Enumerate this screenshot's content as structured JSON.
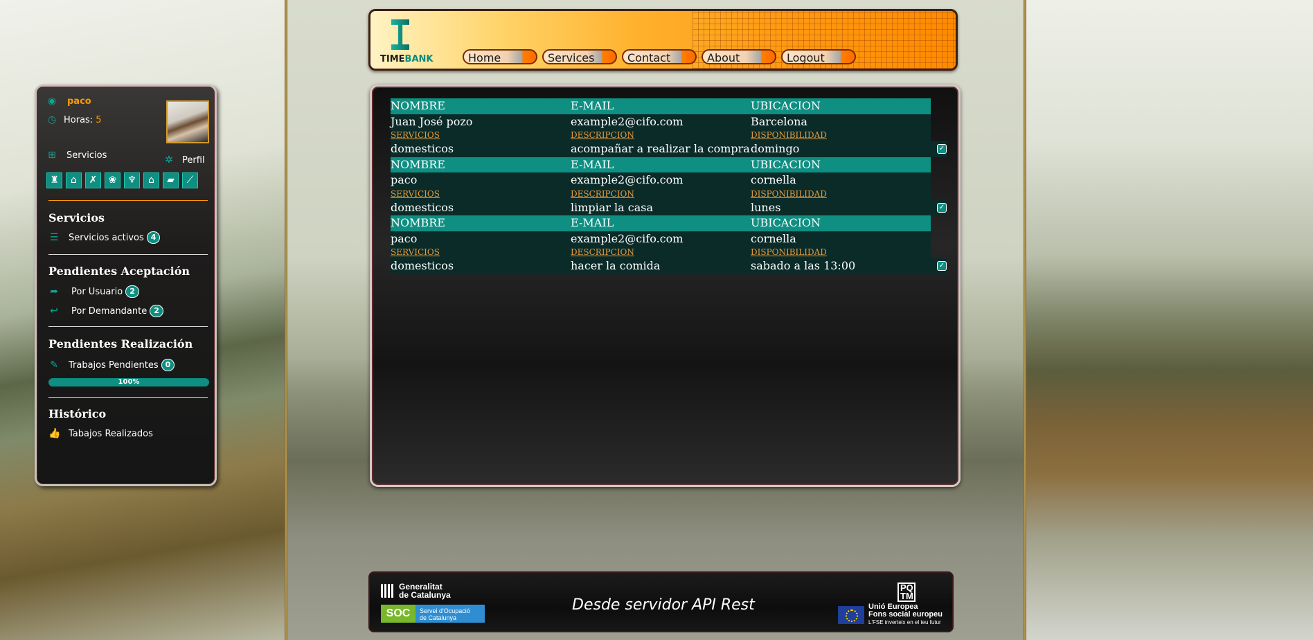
{
  "header": {
    "logo_time": "TIME",
    "logo_bank": "BANK",
    "nav": [
      "Home",
      "Services",
      "Contact",
      "About",
      "Logout"
    ]
  },
  "sidebar": {
    "username": "paco",
    "horas_label": "Horas:",
    "horas_value": "5",
    "servicios_link": "Servicios",
    "perfil_link": "Perfil",
    "service_icons": [
      "babysitter-icon",
      "house-cleaning-icon",
      "broom-icon",
      "gardening-icon",
      "plumbing-icon",
      "home-repair-icon",
      "ironing-icon",
      "sweeping-icon"
    ],
    "sections": {
      "servicios_title": "Servicios",
      "servicios_activos": "Servicios activos",
      "servicios_activos_count": "4",
      "pendientes_aceptacion_title": "Pendientes Aceptación",
      "por_usuario": "Por Usuario",
      "por_usuario_count": "2",
      "por_demandante": "Por Demandante",
      "por_demandante_count": "2",
      "pendientes_realizacion_title": "Pendientes Realización",
      "trabajos_pendientes": "Trabajos Pendientes",
      "trabajos_pendientes_count": "0",
      "progress_label": "100%",
      "progress_value": 100,
      "historico_title": "Histórico",
      "trabajos_realizados": "Tabajos Realizados"
    }
  },
  "table": {
    "headers": [
      "NOMBRE",
      "E-MAIL",
      "UBICACION"
    ],
    "subheaders": [
      "SERVICIOS",
      "DESCRIPCION",
      "DISPONIBILIDAD"
    ],
    "records": [
      {
        "nombre": "Juan José pozo",
        "email": "example2@cifo.com",
        "ubicacion": "Barcelona",
        "servicio": "domesticos",
        "descripcion": "acompañar a realizar la compra",
        "disponibilidad": "domingo"
      },
      {
        "nombre": "paco",
        "email": "example2@cifo.com",
        "ubicacion": "cornella",
        "servicio": "domesticos",
        "descripcion": "limpiar la casa",
        "disponibilidad": "lunes"
      },
      {
        "nombre": "paco",
        "email": "example2@cifo.com",
        "ubicacion": "cornella",
        "servicio": "domesticos",
        "descripcion": "hacer la comida",
        "disponibilidad": "sabado a las 13:00"
      }
    ]
  },
  "footer": {
    "generalitat_line1": "Generalitat",
    "generalitat_line2": "de Catalunya",
    "soc": "SOC",
    "soc_desc_1": "Servei d'Ocupació",
    "soc_desc_2": "de Catalunya",
    "title": "Desde servidor API Rest",
    "pqtm": "PQ TM",
    "eu_1": "Unió Europea",
    "eu_2": "Fons social europeu",
    "eu_3": "L'FSE inverteix en el teu futur"
  },
  "colors": {
    "accent": "#0e8f82",
    "orange": "#ff9a00",
    "link": "#e89a3a"
  }
}
